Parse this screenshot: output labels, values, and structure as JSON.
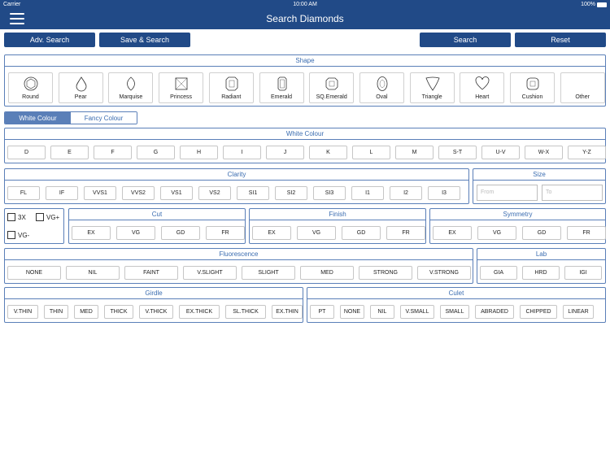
{
  "status": {
    "carrier": "Carrier",
    "time": "10:00 AM",
    "battery": "100%"
  },
  "nav": {
    "title": "Search Diamonds"
  },
  "toolbar": {
    "adv": "Adv. Search",
    "save": "Save & Search",
    "search": "Search",
    "reset": "Reset"
  },
  "shape": {
    "title": "Shape",
    "items": [
      "Round",
      "Pear",
      "Marquise",
      "Princess",
      "Radiant",
      "Emerald",
      "SQ.Emerald",
      "Oval",
      "Triangle",
      "Heart",
      "Cushion",
      "Other"
    ]
  },
  "tabs": {
    "white": "White Colour",
    "fancy": "Fancy Colour"
  },
  "white": {
    "title": "White Colour",
    "items": [
      "D",
      "E",
      "F",
      "G",
      "H",
      "I",
      "J",
      "K",
      "L",
      "M",
      "S-T",
      "U-V",
      "W-X",
      "Y-Z"
    ]
  },
  "clarity": {
    "title": "Clarity",
    "items": [
      "FL",
      "IF",
      "VVS1",
      "VVS2",
      "VS1",
      "VS2",
      "SI1",
      "SI2",
      "SI3",
      "I1",
      "I2",
      "I3"
    ]
  },
  "size": {
    "title": "Size",
    "from": "From",
    "to": "To"
  },
  "checks": {
    "c3x": "3X",
    "vgplus": "VG+",
    "vgminus": "VG-"
  },
  "cut": {
    "title": "Cut",
    "items": [
      "EX",
      "VG",
      "GD",
      "FR"
    ]
  },
  "finish": {
    "title": "Finish",
    "items": [
      "EX",
      "VG",
      "GD",
      "FR"
    ]
  },
  "symmetry": {
    "title": "Symmetry",
    "items": [
      "EX",
      "VG",
      "GD",
      "FR"
    ]
  },
  "fluorescence": {
    "title": "Fluorescence",
    "items": [
      "NONE",
      "NIL",
      "FAINT",
      "V.SLIGHT",
      "SLIGHT",
      "MED",
      "STRONG",
      "V.STRONG"
    ]
  },
  "lab": {
    "title": "Lab",
    "items": [
      "GIA",
      "HRD",
      "IGI"
    ]
  },
  "girdle": {
    "title": "Girdle",
    "items": [
      "V.THIN",
      "THIN",
      "MED",
      "THICK",
      "V.THICK",
      "EX.THICK",
      "SL.THICK",
      "EX.THIN"
    ]
  },
  "culet": {
    "title": "Culet",
    "items": [
      "PT",
      "NONE",
      "NIL",
      "V.SMALL",
      "SMALL",
      "ABRADED",
      "CHIPPED",
      "LINEAR"
    ]
  }
}
